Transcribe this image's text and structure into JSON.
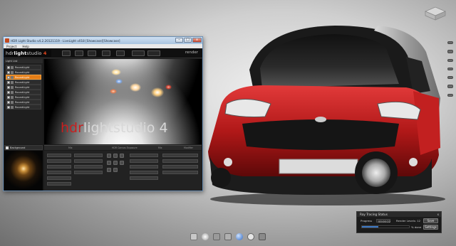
{
  "app_window": {
    "title": "HDR Light Studio v4.2.20121119 - LiveLight v018 [Showcase][Showcase]",
    "menu": [
      "Project",
      "Help"
    ],
    "logo": {
      "prefix": "hdr",
      "bold": "light",
      "suffix": "studio",
      "tag": "4"
    },
    "toolbar_render_label": "render",
    "window_buttons": {
      "minimize": "–",
      "maximize": "□",
      "close": "x"
    },
    "light_list": {
      "header": "Light List",
      "items": [
        {
          "label": "RoundLight",
          "selected": false
        },
        {
          "label": "RoundLight",
          "selected": false
        },
        {
          "label": "RoundLight",
          "selected": true
        },
        {
          "label": "RoundLight",
          "selected": false
        },
        {
          "label": "RoundLight",
          "selected": false
        },
        {
          "label": "RoundLight",
          "selected": false
        },
        {
          "label": "RoundLight",
          "selected": false
        },
        {
          "label": "RoundLight",
          "selected": false
        },
        {
          "label": "RoundLight",
          "selected": false
        }
      ],
      "background_label": "Background"
    },
    "splash": {
      "part1": "hdr",
      "part2": "light",
      "part3": "studio 4"
    },
    "timeline_labels": [
      "Mix",
      "HDR Canvas Exposure",
      "Mix",
      "Modifier"
    ]
  },
  "ray_tracing": {
    "title": "Ray Tracing Status",
    "close": "x",
    "progress_label": "Progress",
    "time": "00:00:22",
    "render_levels_label": "Render Levels: 12",
    "percent_done": "% done",
    "progress_fraction": 0.35,
    "save_button": "Save",
    "settings_button": "Settings"
  },
  "colors": {
    "selection_orange": "#e47d17",
    "car_red": "#c81f1f",
    "progress_blue": "#3c78c4"
  },
  "icons": {
    "right_tools": [
      "select-icon",
      "move-icon",
      "rotate-icon",
      "zoom-icon",
      "light-icon",
      "camera-icon",
      "settings-icon"
    ],
    "dock": [
      "folder-icon",
      "environment-icon",
      "lighting-icon",
      "render-icon",
      "sphere-icon",
      "info-icon",
      "cursor-icon"
    ]
  }
}
